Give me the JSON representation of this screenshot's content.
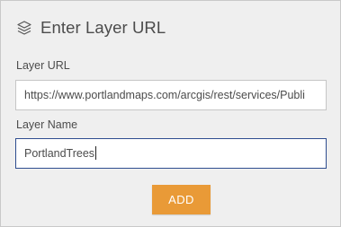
{
  "header": {
    "title": "Enter Layer URL",
    "icon": "layers-icon"
  },
  "layer_url": {
    "label": "Layer URL",
    "value": "https://www.portlandmaps.com/arcgis/rest/services/Publi"
  },
  "layer_name": {
    "label": "Layer Name",
    "value": "PortlandTrees"
  },
  "add_button": {
    "label": "ADD",
    "color": "#e99a37"
  },
  "colors": {
    "background": "#efefef",
    "text": "#4c4c4c",
    "focus_border": "#2e4d8f"
  }
}
